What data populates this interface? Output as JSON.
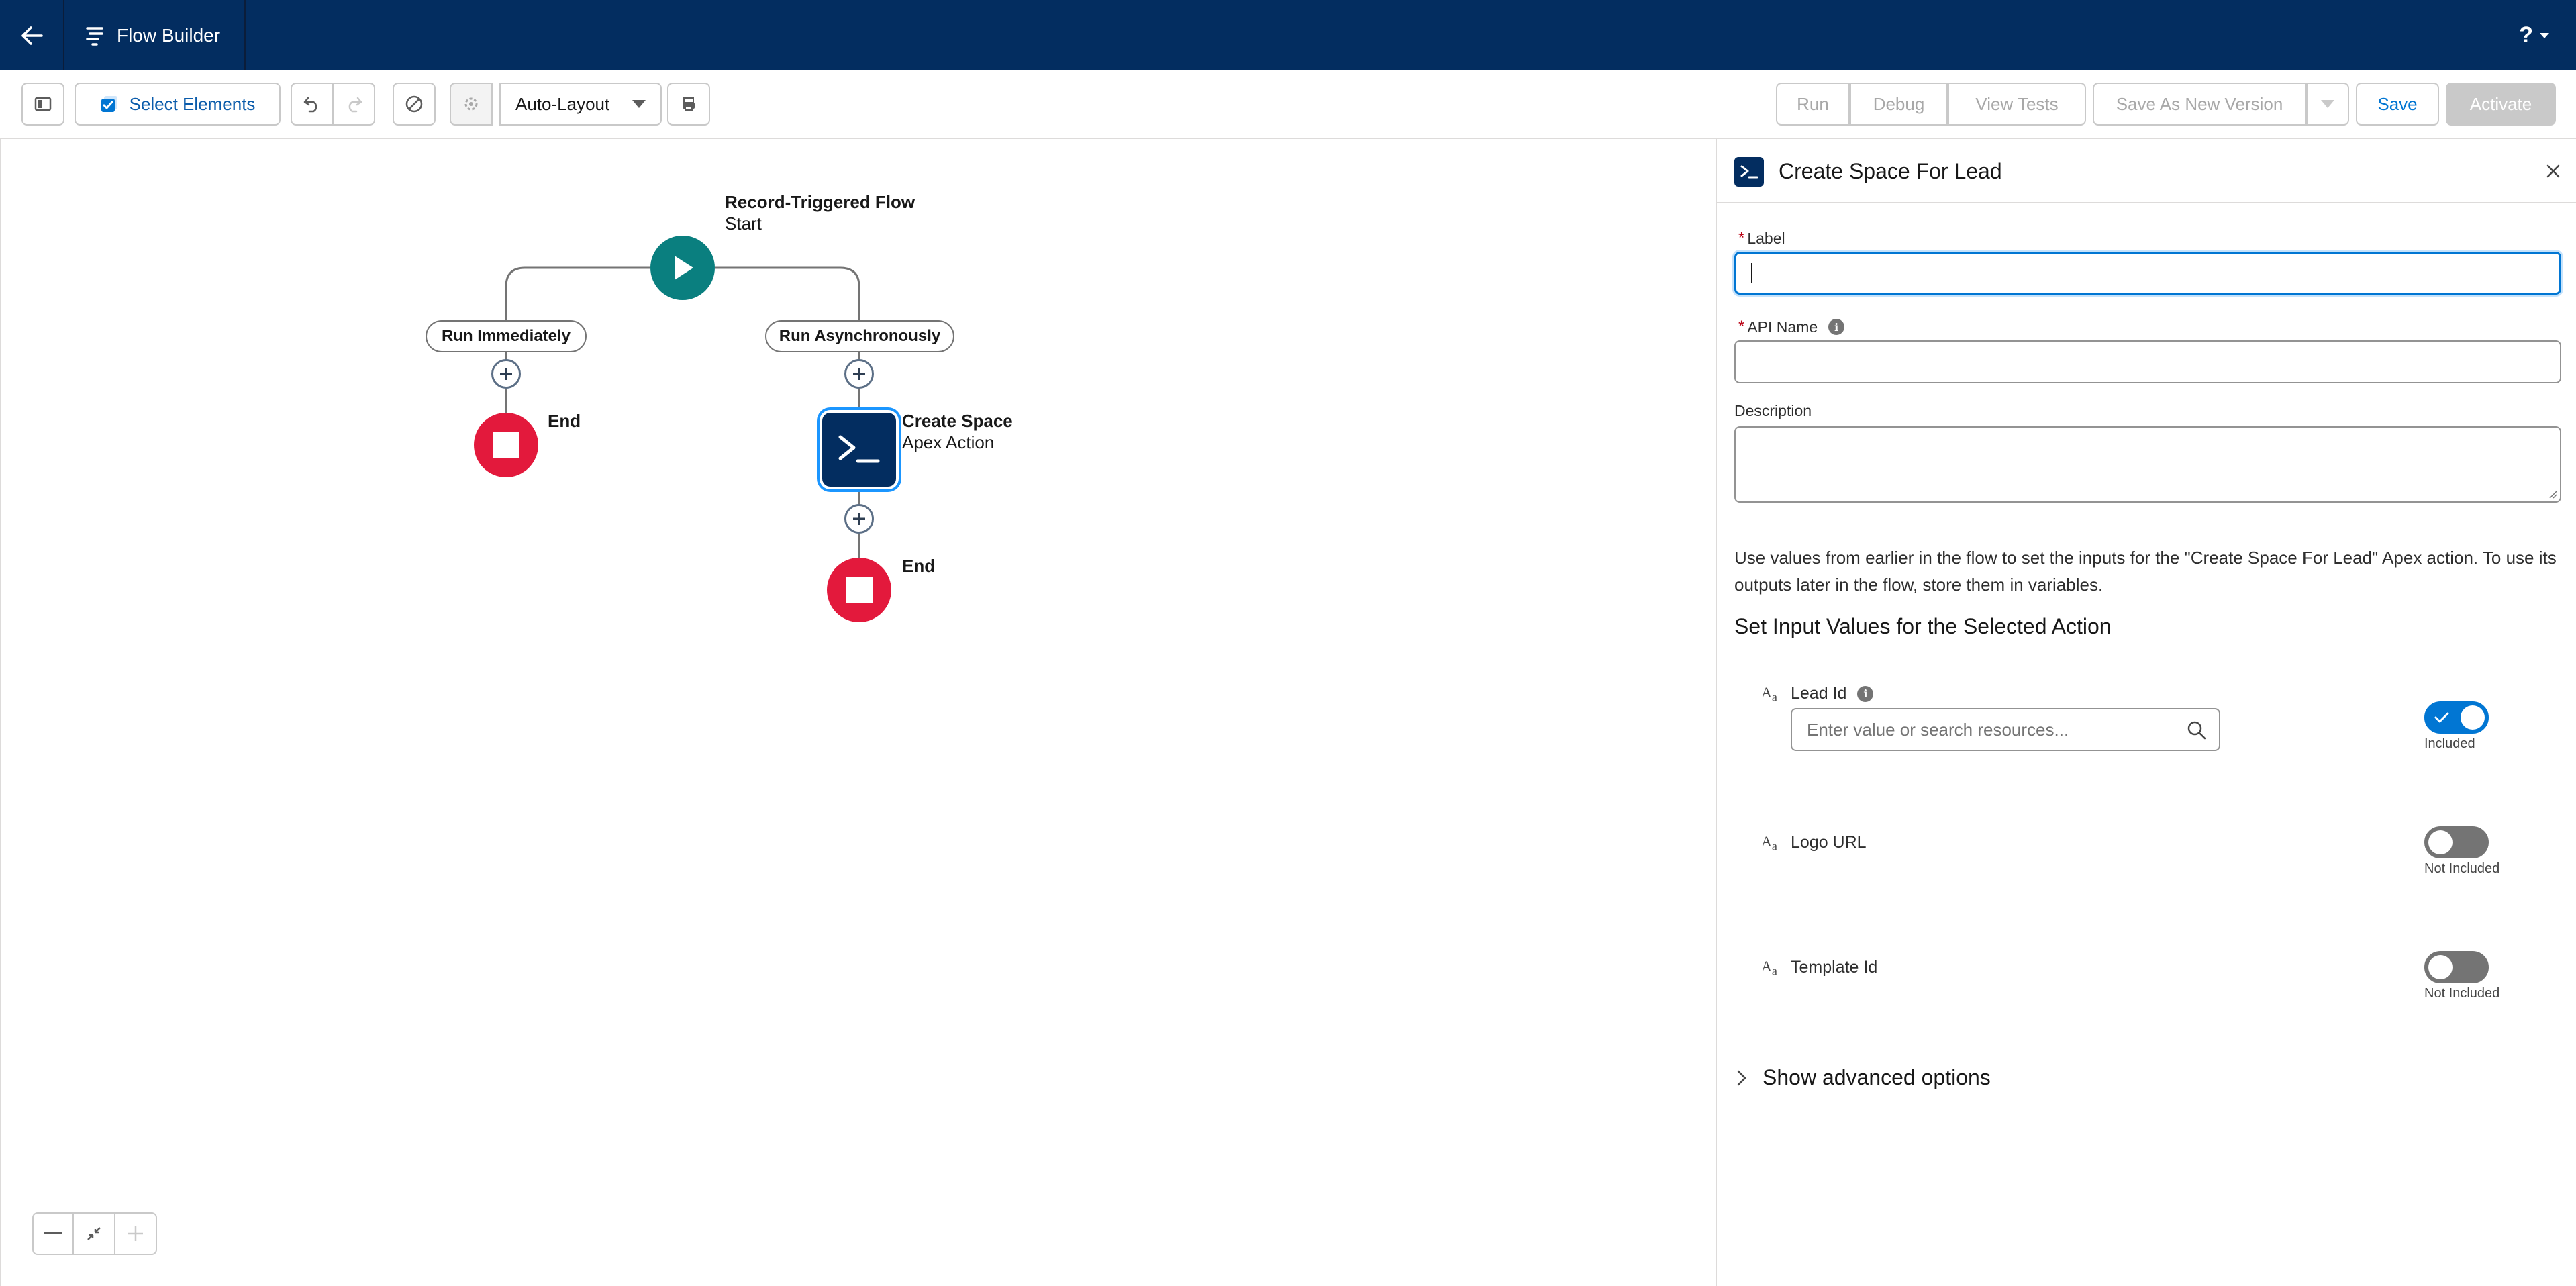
{
  "header": {
    "app_title": "Flow Builder",
    "help_label": "?"
  },
  "toolbar": {
    "select_elements": "Select Elements",
    "layout_select": "Auto-Layout",
    "run": "Run",
    "debug": "Debug",
    "view_tests": "View Tests",
    "save_as_new_version": "Save As New Version",
    "save": "Save",
    "activate": "Activate"
  },
  "canvas": {
    "start": {
      "title": "Record-Triggered Flow",
      "subtitle": "Start"
    },
    "paths": [
      {
        "label": "Run Immediately",
        "end_label": "End"
      },
      {
        "label": "Run Asynchronously",
        "end_label": "End"
      }
    ],
    "action": {
      "title": "Create Space",
      "subtitle": "Apex Action"
    }
  },
  "panel": {
    "title": "Create Space For Lead",
    "label_field": {
      "label": "Label",
      "required_mark": "*",
      "value": ""
    },
    "api_name_field": {
      "label": "API Name",
      "required_mark": "*",
      "value": ""
    },
    "description_field": {
      "label": "Description",
      "value": ""
    },
    "help_text": "Use values from earlier in the flow to set the inputs for the \"Create Space For Lead\" Apex action. To use its outputs later in the flow, store them in variables.",
    "section_title": "Set Input Values for the Selected Action",
    "params": [
      {
        "type_glyph": "A",
        "type_sub": "a",
        "name": "Lead Id",
        "has_info": true,
        "placeholder": "Enter value or search resources...",
        "included": true,
        "status": "Included"
      },
      {
        "type_glyph": "A",
        "type_sub": "a",
        "name": "Logo URL",
        "has_info": false,
        "included": false,
        "status": "Not Included"
      },
      {
        "type_glyph": "A",
        "type_sub": "a",
        "name": "Template Id",
        "has_info": false,
        "included": false,
        "status": "Not Included"
      }
    ],
    "advanced_label": "Show advanced options"
  },
  "colors": {
    "header_bg": "#032d60",
    "brand": "#0176d3",
    "start_node": "#0a7f7f",
    "end_node": "#e3193c",
    "apex_node": "#032d60"
  }
}
